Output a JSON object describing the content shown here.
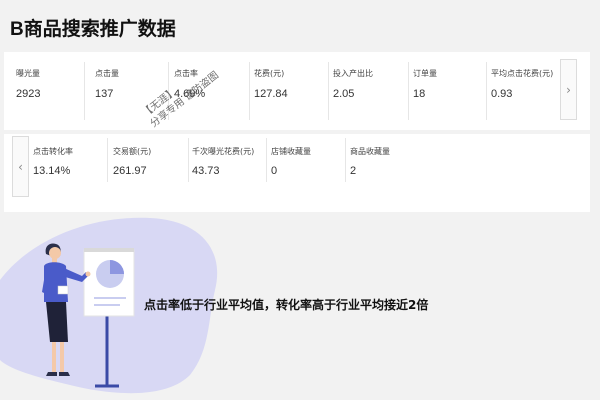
{
  "title": "B商品搜索推广数据",
  "metrics_top": [
    {
      "label": "曝光量",
      "value": "2923"
    },
    {
      "label": "点击量",
      "value": "137"
    },
    {
      "label": "点击率",
      "value": "4.69%"
    },
    {
      "label": "花费(元)",
      "value": "127.84"
    },
    {
      "label": "投入产出比",
      "value": "2.05"
    },
    {
      "label": "订单量",
      "value": "18"
    },
    {
      "label": "平均点击花费(元)",
      "value": "0.93"
    }
  ],
  "metrics_bottom": [
    {
      "label": "点击转化率",
      "value": "13.14%"
    },
    {
      "label": "交易额(元)",
      "value": "261.97"
    },
    {
      "label": "千次曝光花费(元)",
      "value": "43.73"
    },
    {
      "label": "店铺收藏量",
      "value": "0"
    },
    {
      "label": "商品收藏量",
      "value": "2"
    }
  ],
  "nav": {
    "next": "›",
    "prev": "‹"
  },
  "watermark": {
    "line1": "【无涯】",
    "line2": "分享专用 谨防盗图"
  },
  "summary": "点击率低于行业平均值，转化率高于行业平均接近2倍",
  "colors": {
    "blob": "#d8d8f4",
    "figure_blue": "#4a5bc9",
    "board": "#3a4aa6"
  }
}
